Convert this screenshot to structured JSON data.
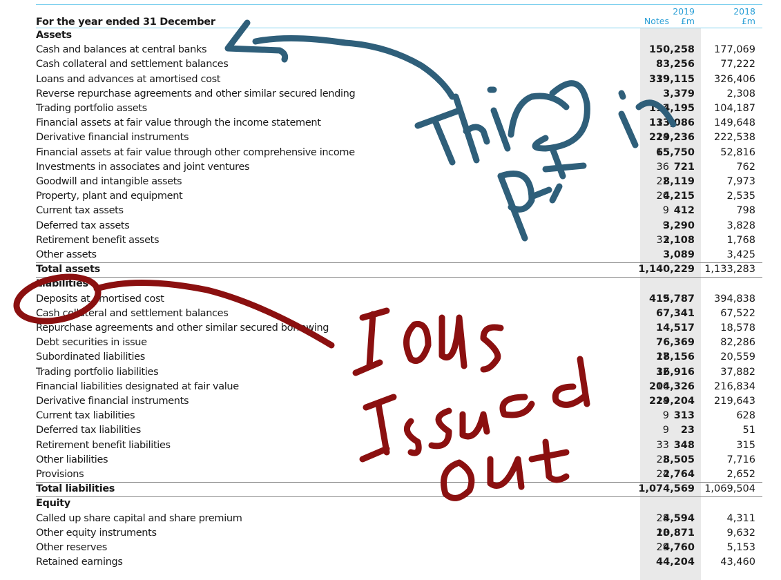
{
  "header": {
    "title": "For the year ended 31 December",
    "notes_label": "Notes",
    "col_2019_year": "2019",
    "col_2019_unit": "£m",
    "col_2018_year": "2018",
    "col_2018_unit": "£m"
  },
  "assets": {
    "heading": "Assets",
    "rows": [
      {
        "label": "Cash and balances at central banks",
        "notes": "",
        "v2019": "150,258",
        "v2018": "177,069"
      },
      {
        "label": "Cash collateral and settlement balances",
        "notes": "",
        "v2019": "83,256",
        "v2018": "77,222"
      },
      {
        "label": "Loans and advances at amortised cost",
        "notes": "19",
        "v2019": "339,115",
        "v2018": "326,406"
      },
      {
        "label": "Reverse repurchase agreements and other similar secured lending",
        "notes": "",
        "v2019": "3,379",
        "v2018": "2,308"
      },
      {
        "label": "Trading portfolio assets",
        "notes": "12",
        "v2019": "114,195",
        "v2018": "104,187"
      },
      {
        "label": "Financial assets at fair value through the income statement",
        "notes": "13",
        "v2019": "133,086",
        "v2018": "149,648"
      },
      {
        "label": "Derivative financial instruments",
        "notes": "14",
        "v2019": "229,236",
        "v2018": "222,538"
      },
      {
        "label": "Financial assets at fair value through other comprehensive income",
        "notes": "15",
        "v2019": "65,750",
        "v2018": "52,816"
      },
      {
        "label": "Investments in associates and joint ventures",
        "notes": "36",
        "v2019": "721",
        "v2018": "762"
      },
      {
        "label": "Goodwill and intangible assets",
        "notes": "22",
        "v2019": "8,119",
        "v2018": "7,973"
      },
      {
        "label": "Property, plant and equipment",
        "notes": "20",
        "v2019": "4,215",
        "v2018": "2,535"
      },
      {
        "label": "Current tax assets",
        "notes": "9",
        "v2019": "412",
        "v2018": "798"
      },
      {
        "label": "Deferred tax assets",
        "notes": "9",
        "v2019": "3,290",
        "v2018": "3,828"
      },
      {
        "label": "Retirement benefit assets",
        "notes": "33",
        "v2019": "2,108",
        "v2018": "1,768"
      },
      {
        "label": "Other assets",
        "notes": "",
        "v2019": "3,089",
        "v2018": "3,425"
      }
    ],
    "total": {
      "label": "Total assets",
      "v2019": "1,140,229",
      "v2018": "1,133,283"
    }
  },
  "liabilities": {
    "heading": "Liabilities",
    "rows": [
      {
        "label": "Deposits at amortised cost",
        "notes": "19",
        "v2019": "415,787",
        "v2018": "394,838"
      },
      {
        "label": "Cash collateral and settlement balances",
        "notes": "",
        "v2019": "67,341",
        "v2018": "67,522"
      },
      {
        "label": "Repurchase agreements and other similar secured borrowing",
        "notes": "",
        "v2019": "14,517",
        "v2018": "18,578"
      },
      {
        "label": "Debt securities in issue",
        "notes": "",
        "v2019": "76,369",
        "v2018": "82,286"
      },
      {
        "label": "Subordinated liabilities",
        "notes": "27",
        "v2019": "18,156",
        "v2018": "20,559"
      },
      {
        "label": "Trading portfolio liabilities",
        "notes": "12",
        "v2019": "36,916",
        "v2018": "37,882"
      },
      {
        "label": "Financial liabilities designated at fair value",
        "notes": "16",
        "v2019": "204,326",
        "v2018": "216,834"
      },
      {
        "label": "Derivative financial instruments",
        "notes": "14",
        "v2019": "229,204",
        "v2018": "219,643"
      },
      {
        "label": "Current tax liabilities",
        "notes": "9",
        "v2019": "313",
        "v2018": "628"
      },
      {
        "label": "Deferred tax liabilities",
        "notes": "9",
        "v2019": "23",
        "v2018": "51"
      },
      {
        "label": "Retirement benefit liabilities",
        "notes": "33",
        "v2019": "348",
        "v2018": "315"
      },
      {
        "label": "Other liabilities",
        "notes": "23",
        "v2019": "8,505",
        "v2018": "7,716"
      },
      {
        "label": "Provisions",
        "notes": "24",
        "v2019": "2,764",
        "v2018": "2,652"
      }
    ],
    "total": {
      "label": "Total liabilities",
      "v2019": "1,074,569",
      "v2018": "1,069,504"
    }
  },
  "equity": {
    "heading": "Equity",
    "rows": [
      {
        "label": "Called up share capital and share premium",
        "notes": "28",
        "v2019": "4,594",
        "v2018": "4,311"
      },
      {
        "label": "Other equity instruments",
        "notes": "28",
        "v2019": "10,871",
        "v2018": "9,632"
      },
      {
        "label": "Other reserves",
        "notes": "29",
        "v2019": "4,760",
        "v2018": "5,153"
      },
      {
        "label": "Retained earnings",
        "notes": "",
        "v2019": "44,204",
        "v2018": "43,460"
      }
    ]
  },
  "annotations": {
    "blue_text": [
      "Thing",
      "put in"
    ],
    "red_text": [
      "IOUs",
      "Issued",
      "out"
    ],
    "blue_color": "#2f5f7a",
    "red_color": "#8b1010"
  }
}
